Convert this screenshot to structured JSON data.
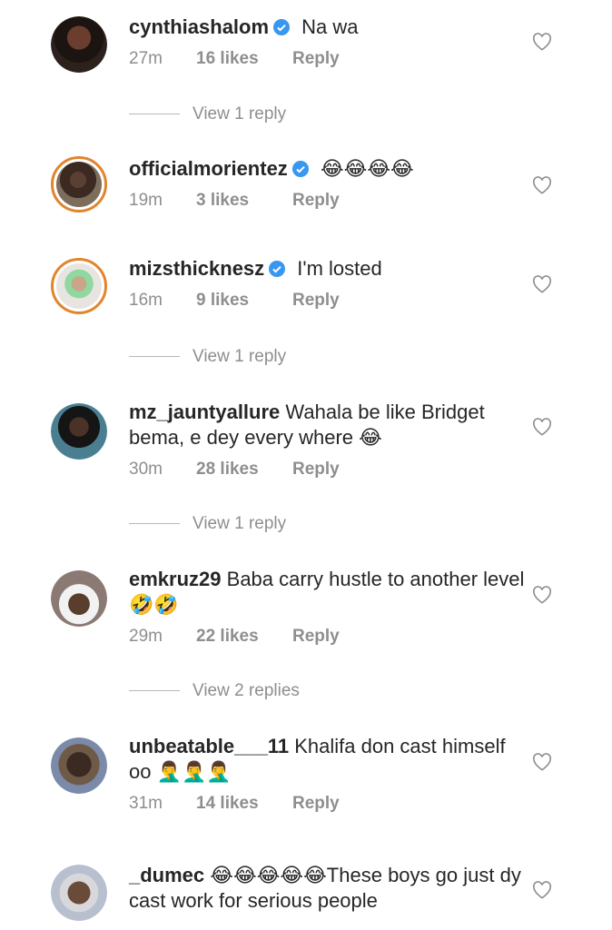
{
  "comments": [
    {
      "username": "cynthiashalom",
      "verified": true,
      "text": "Na wa",
      "time": "27m",
      "likes": "16 likes",
      "reply": "Reply",
      "view_replies": "View 1 reply"
    },
    {
      "username": "officialmorientez",
      "verified": true,
      "text": "😂😂😂😂",
      "time": "19m",
      "likes": "3 likes",
      "reply": "Reply"
    },
    {
      "username": "mizsthicknesz",
      "verified": true,
      "text": "I'm losted",
      "time": "16m",
      "likes": "9 likes",
      "reply": "Reply",
      "view_replies": "View 1 reply"
    },
    {
      "username": "mz_jauntyallure",
      "verified": false,
      "text": "Wahala be like Bridget bema, e dey every where 😂",
      "time": "30m",
      "likes": "28 likes",
      "reply": "Reply",
      "view_replies": "View 1 reply"
    },
    {
      "username": "emkruz29",
      "verified": false,
      "text": "Baba carry hustle to another level 🤣🤣",
      "time": "29m",
      "likes": "22 likes",
      "reply": "Reply",
      "view_replies": "View 2 replies"
    },
    {
      "username": "unbeatable___11",
      "verified": false,
      "text": "Khalifa don cast himself oo 🤦‍♂️🤦‍♂️🤦‍♂️",
      "time": "31m",
      "likes": "14 likes",
      "reply": "Reply"
    },
    {
      "username": "_dumec",
      "verified": false,
      "text": "😂😂😂😂😂These boys go just dy cast work for serious people",
      "time": "",
      "likes": "",
      "reply": ""
    }
  ],
  "colors": {
    "verified": "#3897f0",
    "meta": "#8e8e8e",
    "ring": "#e1852d"
  },
  "icons": {
    "like": "heart-outline-icon",
    "verified": "verified-badge-icon"
  }
}
